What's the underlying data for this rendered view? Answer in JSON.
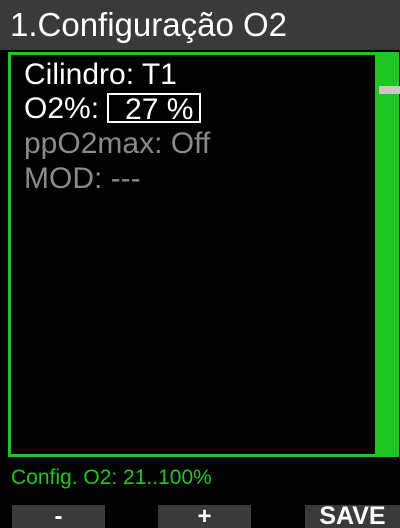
{
  "header": {
    "title": "1.Configuração O2"
  },
  "menu": {
    "cylinder": {
      "label": "Cilindro: T1"
    },
    "o2": {
      "label": "O2%:",
      "value": "27 %"
    },
    "ppo2max": {
      "label": "ppO2max: Off"
    },
    "mod": {
      "label": "MOD: ---"
    }
  },
  "info": {
    "text": "Config. O2: 21..100%"
  },
  "buttons": {
    "minus": "-",
    "plus": "+",
    "save": "SAVE"
  },
  "colors": {
    "accent": "#1fc61f",
    "bar": "#3a3a3a",
    "disabled": "#8a8a8a"
  }
}
